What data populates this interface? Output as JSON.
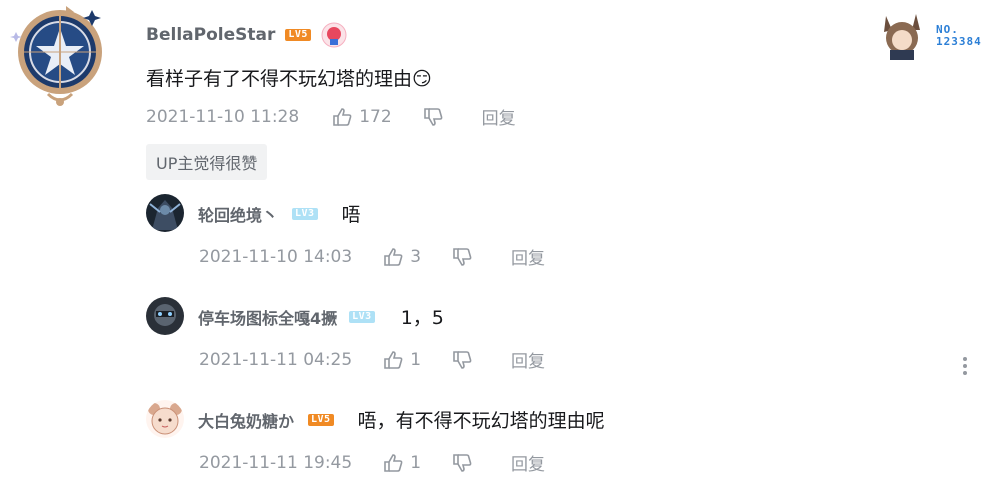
{
  "main_comment": {
    "username": "BellaPoleStar",
    "level": "LV5",
    "text": "看样子有了不得不玩幻塔的理由",
    "emoji": "😏",
    "timestamp": "2021-11-10 11:28",
    "likes": "172",
    "reply_label": "回复",
    "up_tag": "UP主觉得很赞"
  },
  "fan_medal": {
    "label": "NO.",
    "number": "123384"
  },
  "replies": [
    {
      "username": "轮回绝境丶",
      "level": "LV3",
      "text": "唔",
      "timestamp": "2021-11-10 14:03",
      "likes": "3",
      "reply_label": "回复"
    },
    {
      "username": "停车场图标全嘎4撅",
      "level": "LV3",
      "text": "1，5",
      "timestamp": "2021-11-11 04:25",
      "likes": "1",
      "reply_label": "回复"
    },
    {
      "username": "大白兔奶糖か",
      "level": "LV5",
      "text": "唔，有不得不玩幻塔的理由呢",
      "timestamp": "2021-11-11 19:45",
      "likes": "1",
      "reply_label": "回复"
    }
  ],
  "colors": {
    "lv_orange": "#f08a24",
    "lv_blue": "#aee1f6",
    "meta_gray": "#9499a0"
  }
}
